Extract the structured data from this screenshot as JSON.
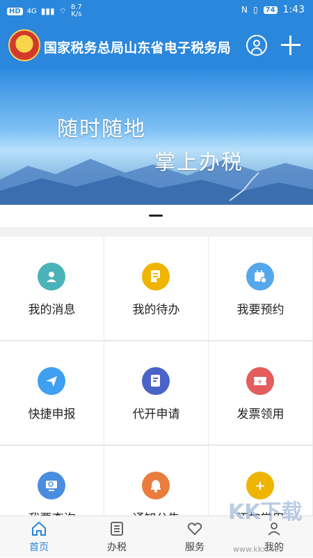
{
  "status_bar": {
    "left_badges": [
      "HD",
      "4G"
    ],
    "speed_value": "8.7",
    "speed_unit": "K/s",
    "battery": "74",
    "time": "1:43"
  },
  "app_bar": {
    "title": "国家税务总局山东省电子税务局"
  },
  "banner": {
    "slogan_line1": "随时随地",
    "slogan_line2": "掌上办税"
  },
  "tiles": [
    {
      "label": "我的消息",
      "color": "#4ab2b8",
      "icon": "user-icon"
    },
    {
      "label": "我的待办",
      "color": "#efb400",
      "icon": "todo-icon"
    },
    {
      "label": "我要预约",
      "color": "#55a6ea",
      "icon": "calendar-icon"
    },
    {
      "label": "快捷申报",
      "color": "#3f9ff0",
      "icon": "send-icon"
    },
    {
      "label": "代开申请",
      "color": "#4a63c8",
      "icon": "document-edit-icon"
    },
    {
      "label": "发票领用",
      "color": "#e45c5c",
      "icon": "ticket-icon"
    },
    {
      "label": "我要查询",
      "color": "#4a8ce0",
      "icon": "search-monitor-icon"
    },
    {
      "label": "通知公告",
      "color": "#ea7c3e",
      "icon": "bell-icon"
    },
    {
      "label": "添加常用",
      "color": "#efb400",
      "icon": "plus-icon"
    }
  ],
  "tabs": [
    {
      "label": "首页",
      "icon": "home-icon",
      "active": true
    },
    {
      "label": "办税",
      "icon": "list-icon",
      "active": false
    },
    {
      "label": "服务",
      "icon": "heart-icon",
      "active": false
    },
    {
      "label": "我的",
      "icon": "person-icon",
      "active": false
    }
  ],
  "watermark": {
    "text": "KK下载",
    "site": "www.kkx.net"
  }
}
